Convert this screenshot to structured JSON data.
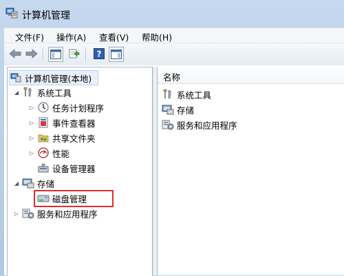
{
  "window": {
    "title": "计算机管理"
  },
  "menu": [
    "文件(F)",
    "操作(A)",
    "查看(V)",
    "帮助(H)"
  ],
  "tree": {
    "root": "计算机管理(本地)",
    "system_tools": {
      "label": "系统工具",
      "children": [
        "任务计划程序",
        "事件查看器",
        "共享文件夹",
        "性能",
        "设备管理器"
      ]
    },
    "storage": {
      "label": "存储",
      "children": [
        "磁盘管理"
      ]
    },
    "services": {
      "label": "服务和应用程序"
    }
  },
  "list": {
    "header": "名称",
    "items": [
      "系统工具",
      "存储",
      "服务和应用程序"
    ]
  },
  "colors": {
    "highlight": "#e02b2b",
    "accent": "#2a6bd6"
  }
}
